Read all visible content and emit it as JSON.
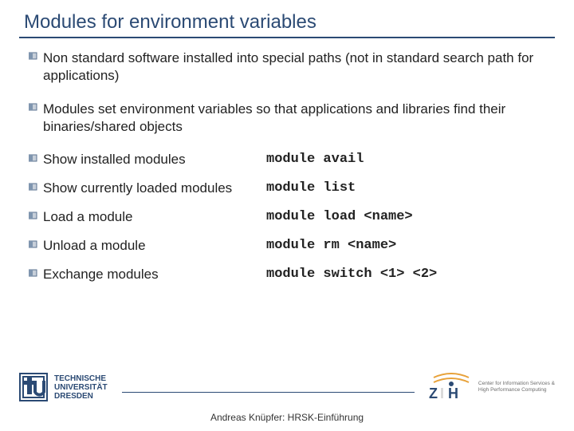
{
  "title": "Modules for environment variables",
  "bullets": [
    "Non standard software installed into special paths (not in standard search path for applications)",
    "Modules set environment variables so that applications and libraries find their binaries/shared objects"
  ],
  "commands": [
    {
      "label": "Show installed modules",
      "code": "module avail"
    },
    {
      "label": "Show currently loaded modules",
      "code": "module list"
    },
    {
      "label": "Load a module",
      "code": "module load <name>"
    },
    {
      "label": "Unload a module",
      "code": "module rm <name>"
    },
    {
      "label": "Exchange modules",
      "code": "module switch <1> <2>"
    }
  ],
  "footer": {
    "tu_line1": "TECHNISCHE",
    "tu_line2": "UNIVERSITÄT",
    "tu_line3": "DRESDEN",
    "zih_name": "ZIH",
    "zih_line1": "Center for Information Services &",
    "zih_line2": "High Performance Computing",
    "caption": "Andreas Knüpfer: HRSK-Einführung"
  }
}
